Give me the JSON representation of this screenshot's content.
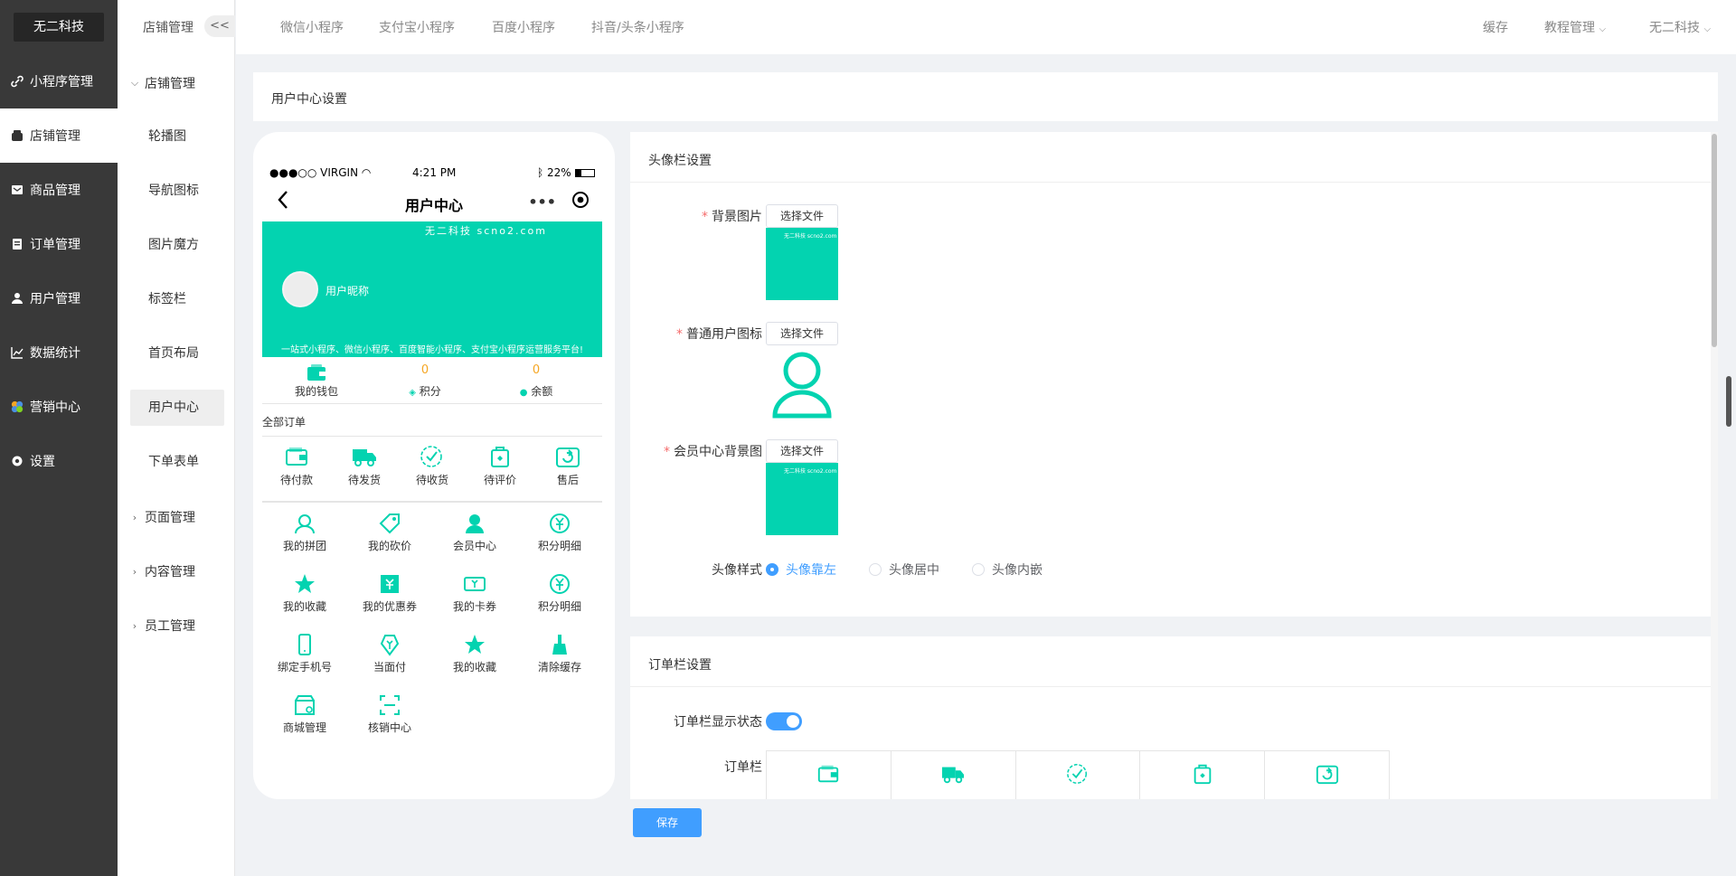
{
  "sidebar": {
    "brand": "无二科技",
    "items": [
      {
        "label": "小程序管理",
        "icon": "link-icon"
      },
      {
        "label": "店铺管理",
        "icon": "store-icon"
      },
      {
        "label": "商品管理",
        "icon": "goods-icon"
      },
      {
        "label": "订单管理",
        "icon": "order-icon"
      },
      {
        "label": "用户管理",
        "icon": "user-icon"
      },
      {
        "label": "数据统计",
        "icon": "chart-icon"
      },
      {
        "label": "营销中心",
        "icon": "marketing-icon"
      },
      {
        "label": "设置",
        "icon": "gear-icon"
      }
    ],
    "active_index": 1
  },
  "submenu": {
    "header": "店铺管理",
    "collapse": "<<",
    "group_open": "店铺管理",
    "items": [
      "轮播图",
      "导航图标",
      "图片魔方",
      "标签栏",
      "首页布局",
      "用户中心",
      "下单表单"
    ],
    "active_item": "用户中心",
    "groups_closed": [
      "页面管理",
      "内容管理",
      "员工管理"
    ]
  },
  "topbar": {
    "tabs": [
      "微信小程序",
      "支付宝小程序",
      "百度小程序",
      "抖音/头条小程序"
    ],
    "right": [
      "缓存",
      "教程管理",
      "无二科技"
    ]
  },
  "page_title": "用户中心设置",
  "phone": {
    "carrier": "●●●○○ VIRGIN",
    "time": "4:21 PM",
    "battery": "22%",
    "title": "用户中心",
    "nickname": "用户昵称",
    "watermark": "无二科技 scno2.com",
    "slogan": "一站式小程序、微信小程序、百度智能小程序、支付宝小程序运营服务平台!",
    "stats": [
      {
        "value": "",
        "label": "我的钱包"
      },
      {
        "value": "0",
        "label": "积分"
      },
      {
        "value": "0",
        "label": "余额"
      }
    ],
    "all_orders": "全部订单",
    "orders": [
      "待付款",
      "待发货",
      "待收货",
      "待评价",
      "售后"
    ],
    "grid": [
      "我的拼团",
      "我的砍价",
      "会员中心",
      "积分明细",
      "我的收藏",
      "我的优惠券",
      "我的卡券",
      "积分明细",
      "绑定手机号",
      "当面付",
      "我的收藏",
      "清除缓存",
      "商城管理",
      "核销中心"
    ]
  },
  "avatar_card": {
    "title": "头像栏设置",
    "bg_label": "背景图片",
    "icon_label": "普通用户图标",
    "member_bg_label": "会员中心背景图",
    "file_button": "选择文件",
    "style_label": "头像样式",
    "styles": [
      "头像靠左",
      "头像居中",
      "头像内嵌"
    ],
    "selected_style": "头像靠左"
  },
  "order_card": {
    "title": "订单栏设置",
    "show_label": "订单栏显示状态",
    "show_enabled": true,
    "bar_label": "订单栏"
  },
  "save_button": "保存",
  "colors": {
    "accent": "#03d3b0",
    "primary": "#409eff",
    "sidebar": "#393939"
  }
}
